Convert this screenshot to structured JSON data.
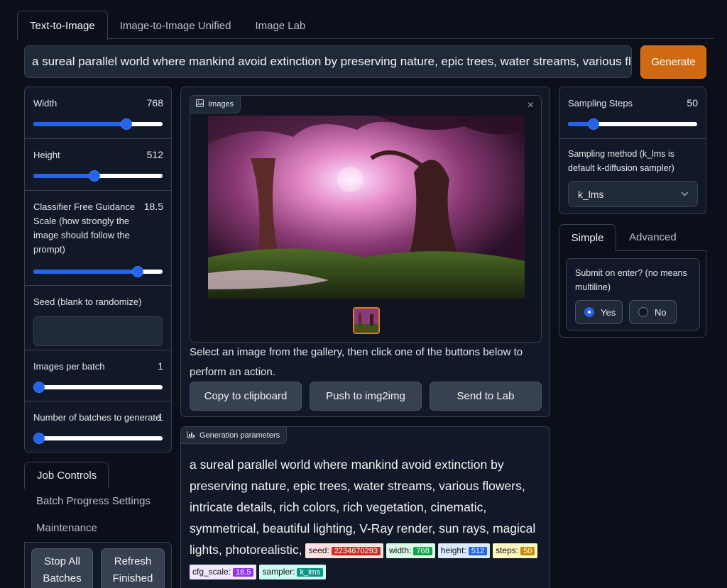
{
  "tabs": [
    "Text-to-Image",
    "Image-to-Image Unified",
    "Image Lab"
  ],
  "prompt": "a sureal parallel world where mankind avoid extinction by preserving nature, epic trees, water streams, various flowers",
  "generate_label": "Generate",
  "left": {
    "width": {
      "label": "Width",
      "value": "768",
      "fraction": 0.72
    },
    "height": {
      "label": "Height",
      "value": "512",
      "fraction": 0.47
    },
    "cfg": {
      "label": "Classifier Free Guidance Scale (how strongly the image should follow the prompt)",
      "value": "18.5",
      "fraction": 0.81
    },
    "seed": {
      "label": "Seed (blank to randomize)",
      "value": ""
    },
    "images_per_batch": {
      "label": "Images per batch",
      "value": "1",
      "fraction": 0
    },
    "batches": {
      "label": "Number of batches to generate",
      "value": "1",
      "fraction": 0
    }
  },
  "left_tabs": {
    "active": "Job Controls",
    "others": [
      "Batch Progress Settings",
      "Maintenance"
    ],
    "stop_label": "Stop All Batches",
    "refresh_label": "Refresh Finished"
  },
  "gallery": {
    "label": "Images",
    "close": "×",
    "help": "Select an image from the gallery, then click one of the buttons below to perform an action.",
    "buttons": [
      "Copy to clipboard",
      "Push to img2img",
      "Send to Lab"
    ]
  },
  "params": {
    "label": "Generation parameters",
    "text": " a sureal parallel world where mankind avoid extinction by preserving nature, epic trees, water streams, various flowers, intricate details, rich colors, rich vegetation, cinematic, symmetrical, beautiful lighting, V-Ray render, sun rays, magical lights, photorealistic,",
    "chips": [
      {
        "key": "seed:",
        "val": "2234670293",
        "cls": "c-seed"
      },
      {
        "key": "width:",
        "val": "768",
        "cls": "c-width"
      },
      {
        "key": "height:",
        "val": "512",
        "cls": "c-height"
      },
      {
        "key": "steps:",
        "val": "50",
        "cls": "c-steps"
      },
      {
        "key": "cfg_scale:",
        "val": "18.5",
        "cls": "c-cfg"
      },
      {
        "key": "sampler:",
        "val": "k_lms",
        "cls": "c-sampler"
      }
    ]
  },
  "right": {
    "steps": {
      "label": "Sampling Steps",
      "value": "50",
      "fraction": 0.2
    },
    "method_label": "Sampling method (k_lms is default k-diffusion sampler)",
    "method_value": "k_lms",
    "tabs": [
      "Simple",
      "Advanced"
    ],
    "submit_label": "Submit on enter? (no means multiline)",
    "options": [
      "Yes",
      "No"
    ]
  },
  "colors": {
    "accent": "#2563eb",
    "generate": "#cf6a13",
    "bg": "#0b0f19",
    "panel": "#111827"
  }
}
